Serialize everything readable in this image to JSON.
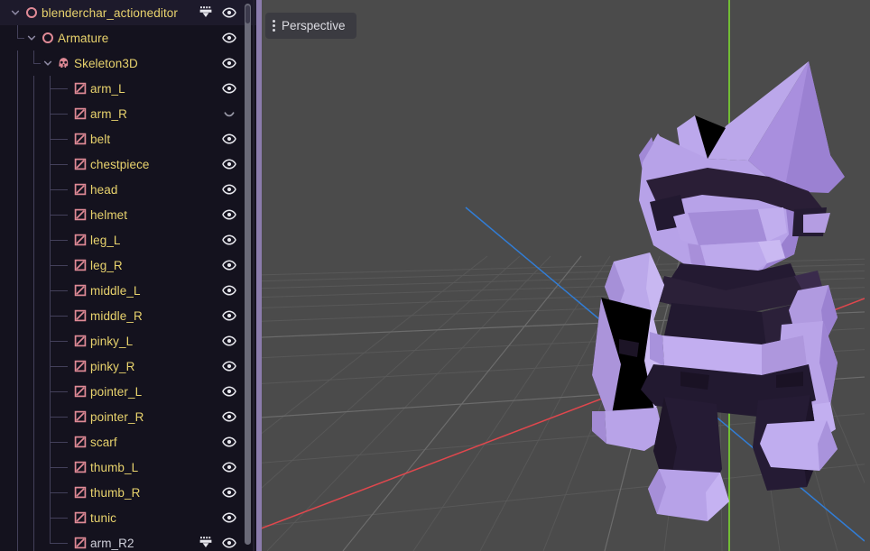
{
  "scene_panel": {
    "name": "scene-tree-dock",
    "scrollbar_visible": true,
    "rows": [
      {
        "label": "blenderchar_actioneditor",
        "depth": 0,
        "icon": "node3d-icon",
        "expanded": true,
        "eye": "visible",
        "anim_icon": true,
        "label_color": "#e9d36d"
      },
      {
        "label": "Armature",
        "depth": 1,
        "icon": "node3d-icon",
        "expanded": true,
        "eye": "visible",
        "anim_icon": false,
        "label_color": "#e9d36d"
      },
      {
        "label": "Skeleton3D",
        "depth": 2,
        "icon": "skeleton3d-icon",
        "expanded": true,
        "eye": "visible",
        "anim_icon": false,
        "label_color": "#e9d36d"
      },
      {
        "label": "arm_L",
        "depth": 3,
        "icon": "meshinstance3d-icon",
        "expanded": false,
        "eye": "visible",
        "anim_icon": false,
        "label_color": "#e9d36d"
      },
      {
        "label": "arm_R",
        "depth": 3,
        "icon": "meshinstance3d-icon",
        "expanded": false,
        "eye": "hidden",
        "anim_icon": false,
        "label_color": "#e9d36d"
      },
      {
        "label": "belt",
        "depth": 3,
        "icon": "meshinstance3d-icon",
        "expanded": false,
        "eye": "visible",
        "anim_icon": false,
        "label_color": "#e9d36d"
      },
      {
        "label": "chestpiece",
        "depth": 3,
        "icon": "meshinstance3d-icon",
        "expanded": false,
        "eye": "visible",
        "anim_icon": false,
        "label_color": "#e9d36d"
      },
      {
        "label": "head",
        "depth": 3,
        "icon": "meshinstance3d-icon",
        "expanded": false,
        "eye": "visible",
        "anim_icon": false,
        "label_color": "#e9d36d"
      },
      {
        "label": "helmet",
        "depth": 3,
        "icon": "meshinstance3d-icon",
        "expanded": false,
        "eye": "visible",
        "anim_icon": false,
        "label_color": "#e9d36d"
      },
      {
        "label": "leg_L",
        "depth": 3,
        "icon": "meshinstance3d-icon",
        "expanded": false,
        "eye": "visible",
        "anim_icon": false,
        "label_color": "#e9d36d"
      },
      {
        "label": "leg_R",
        "depth": 3,
        "icon": "meshinstance3d-icon",
        "expanded": false,
        "eye": "visible",
        "anim_icon": false,
        "label_color": "#e9d36d"
      },
      {
        "label": "middle_L",
        "depth": 3,
        "icon": "meshinstance3d-icon",
        "expanded": false,
        "eye": "visible",
        "anim_icon": false,
        "label_color": "#e9d36d"
      },
      {
        "label": "middle_R",
        "depth": 3,
        "icon": "meshinstance3d-icon",
        "expanded": false,
        "eye": "visible",
        "anim_icon": false,
        "label_color": "#e9d36d"
      },
      {
        "label": "pinky_L",
        "depth": 3,
        "icon": "meshinstance3d-icon",
        "expanded": false,
        "eye": "visible",
        "anim_icon": false,
        "label_color": "#e9d36d"
      },
      {
        "label": "pinky_R",
        "depth": 3,
        "icon": "meshinstance3d-icon",
        "expanded": false,
        "eye": "visible",
        "anim_icon": false,
        "label_color": "#e9d36d"
      },
      {
        "label": "pointer_L",
        "depth": 3,
        "icon": "meshinstance3d-icon",
        "expanded": false,
        "eye": "visible",
        "anim_icon": false,
        "label_color": "#e9d36d"
      },
      {
        "label": "pointer_R",
        "depth": 3,
        "icon": "meshinstance3d-icon",
        "expanded": false,
        "eye": "visible",
        "anim_icon": false,
        "label_color": "#e9d36d"
      },
      {
        "label": "scarf",
        "depth": 3,
        "icon": "meshinstance3d-icon",
        "expanded": false,
        "eye": "visible",
        "anim_icon": false,
        "label_color": "#e9d36d"
      },
      {
        "label": "thumb_L",
        "depth": 3,
        "icon": "meshinstance3d-icon",
        "expanded": false,
        "eye": "visible",
        "anim_icon": false,
        "label_color": "#e9d36d"
      },
      {
        "label": "thumb_R",
        "depth": 3,
        "icon": "meshinstance3d-icon",
        "expanded": false,
        "eye": "visible",
        "anim_icon": false,
        "label_color": "#e9d36d"
      },
      {
        "label": "tunic",
        "depth": 3,
        "icon": "meshinstance3d-icon",
        "expanded": false,
        "eye": "visible",
        "anim_icon": false,
        "label_color": "#e9d36d"
      },
      {
        "label": "arm_R2",
        "depth": 3,
        "icon": "meshinstance3d-icon",
        "expanded": false,
        "eye": "visible",
        "anim_icon": true,
        "label_color": "#cfd0da"
      }
    ]
  },
  "viewport": {
    "perspective_button_label": "Perspective",
    "menu_icon": "vertical-dots-icon",
    "background_color": "#4b4b4b",
    "grid_color": "#5c5c5c",
    "axis_x_color": "#f04e54",
    "axis_y_color": "#7ee02c",
    "axis_z_color": "#2b7fe0",
    "model_color": "#b49ae4",
    "model_shadow_color": "#1a1320"
  },
  "theme": {
    "panel_background": "#14121e",
    "splitter_color": "#8b7cac",
    "tree_guide_color": "#43405a",
    "node_icon_color": "#e08a96",
    "label_accent": "#e9d36d",
    "label_plain": "#cfd0da"
  }
}
